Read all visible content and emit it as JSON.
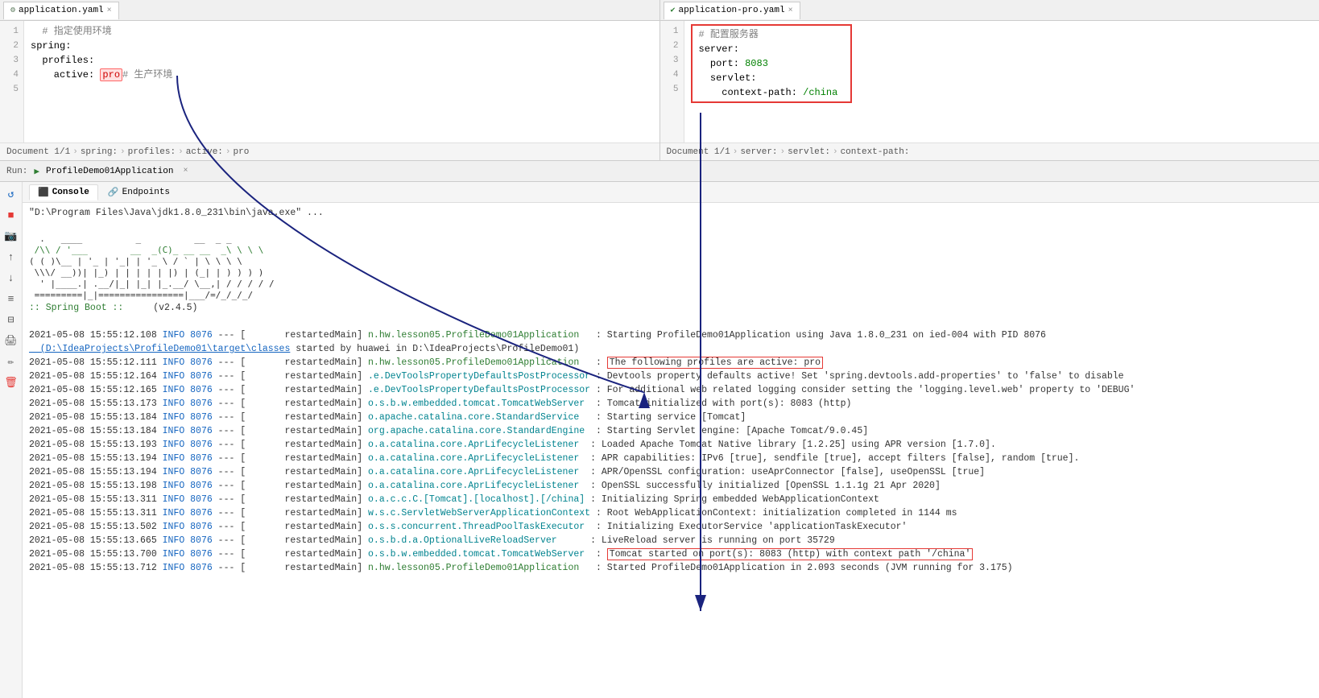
{
  "editors": {
    "left": {
      "tab_label": "application.yaml",
      "tab_icon": "⚙",
      "lines": [
        {
          "num": 1,
          "content": "  # 指定使用环境"
        },
        {
          "num": 2,
          "content": "spring:"
        },
        {
          "num": 3,
          "content": "  profiles:"
        },
        {
          "num": 4,
          "content": "    active: pro# 生产环境"
        },
        {
          "num": 5,
          "content": ""
        }
      ],
      "breadcrumb": [
        "Document 1/1",
        "spring:",
        "profiles:",
        "active:",
        "pro"
      ]
    },
    "right": {
      "tab_label": "application-pro.yaml",
      "tab_icon": "⚙",
      "lines": [
        {
          "num": 1,
          "content": "# 配置服务器"
        },
        {
          "num": 2,
          "content": "server:"
        },
        {
          "num": 3,
          "content": "  port: 8083"
        },
        {
          "num": 4,
          "content": "  servlet:"
        },
        {
          "num": 5,
          "content": "    context-path: /china"
        }
      ],
      "breadcrumb": [
        "Document 1/1",
        "server:",
        "servlet:",
        "context-path:"
      ]
    }
  },
  "run": {
    "label": "Run:",
    "app_name": "ProfileDemo01Application",
    "console_tab": "Console",
    "endpoints_tab": "Endpoints"
  },
  "console": {
    "java_cmd": "\"D:\\Program Files\\Java\\jdk1.8.0_231\\bin\\java.exe\" ...",
    "spring_boot_version": "(v2.4.5)",
    "spring_boot_label": ":: Spring Boot ::",
    "log_lines": [
      {
        "timestamp": "2021-05-08 15:55:12.108",
        "level": "INFO",
        "pid": "8076",
        "thread": "restartedMain",
        "class": "n.hw.lesson05.ProfileDemo01Application",
        "message": ": Starting ProfileDemo01Application using Java 1.8.0_231 on ied-004 with PID 8076"
      },
      {
        "indent": true,
        "message": "(D:\\IdeaProjects\\ProfileDemo01\\target\\classes started by huawei in D:\\IdeaProjects\\ProfileDemo01)"
      },
      {
        "timestamp": "2021-05-08 15:55:12.111",
        "level": "INFO",
        "pid": "8076",
        "thread": "restartedMain",
        "class": "n.hw.lesson05.ProfileDemo01Application",
        "message": ": The following profiles are active: pro",
        "highlight_msg": true
      },
      {
        "timestamp": "2021-05-08 15:55:12.164",
        "level": "INFO",
        "pid": "8076",
        "thread": "restartedMain",
        "class": ".e.DevToolsPropertyDefaultsPostProcessor",
        "message": ": Devtools property defaults active! Set 'spring.devtools.add-properties' to 'false' to disable"
      },
      {
        "timestamp": "2021-05-08 15:55:12.165",
        "level": "INFO",
        "pid": "8076",
        "thread": "restartedMain",
        "class": ".e.DevToolsPropertyDefaultsPostProcessor",
        "message": ": For additional web related logging consider setting the 'logging.level.web' property to 'DEBUG'"
      },
      {
        "timestamp": "2021-05-08 15:55:13.173",
        "level": "INFO",
        "pid": "8076",
        "thread": "restartedMain",
        "class": "o.s.b.w.embedded.tomcat.TomcatWebServer",
        "message": ": Tomcat initialized with port(s): 8083 (http)"
      },
      {
        "timestamp": "2021-05-08 15:55:13.184",
        "level": "INFO",
        "pid": "8076",
        "thread": "restartedMain",
        "class": "o.apache.catalina.core.StandardService",
        "message": ": Starting service [Tomcat]"
      },
      {
        "timestamp": "2021-05-08 15:55:13.184",
        "level": "INFO",
        "pid": "8076",
        "thread": "restartedMain",
        "class": "org.apache.catalina.core.StandardEngine",
        "message": ": Starting Servlet engine: [Apache Tomcat/9.0.45]"
      },
      {
        "timestamp": "2021-05-08 15:55:13.193",
        "level": "INFO",
        "pid": "8076",
        "thread": "restartedMain",
        "class": "o.a.catalina.core.AprLifecycleListener",
        "message": ": Loaded Apache Tomcat Native library [1.2.25] using APR version [1.7.0]."
      },
      {
        "timestamp": "2021-05-08 15:55:13.194",
        "level": "INFO",
        "pid": "8076",
        "thread": "restartedMain",
        "class": "o.a.catalina.core.AprLifecycleListener",
        "message": ": APR capabilities: IPv6 [true], sendfile [true], accept filters [false], random [true]."
      },
      {
        "timestamp": "2021-05-08 15:55:13.194",
        "level": "INFO",
        "pid": "8076",
        "thread": "restartedMain",
        "class": "o.a.catalina.core.AprLifecycleListener",
        "message": ": APR/OpenSSL configuration: useAprConnector [false], useOpenSSL [true]"
      },
      {
        "timestamp": "2021-05-08 15:55:13.198",
        "level": "INFO",
        "pid": "8076",
        "thread": "restartedMain",
        "class": "o.a.catalina.core.AprLifecycleListener",
        "message": ": OpenSSL successfully initialized [OpenSSL 1.1.1g  21 Apr 2020]"
      },
      {
        "timestamp": "2021-05-08 15:55:13.311",
        "level": "INFO",
        "pid": "8076",
        "thread": "restartedMain",
        "class": "o.a.c.c.C.[Tomcat].[localhost].[/china]",
        "message": ": Initializing Spring embedded WebApplicationContext"
      },
      {
        "timestamp": "2021-05-08 15:55:13.311",
        "level": "INFO",
        "pid": "8076",
        "thread": "restartedMain",
        "class": "w.s.c.ServletWebServerApplicationContext",
        "message": ": Root WebApplicationContext: initialization completed in 1144 ms"
      },
      {
        "timestamp": "2021-05-08 15:55:13.502",
        "level": "INFO",
        "pid": "8076",
        "thread": "restartedMain",
        "class": "o.s.s.concurrent.ThreadPoolTaskExecutor",
        "message": ": Initializing ExecutorService 'applicationTaskExecutor'"
      },
      {
        "timestamp": "2021-05-08 15:55:13.665",
        "level": "INFO",
        "pid": "8076",
        "thread": "restartedMain",
        "class": "o.s.b.d.a.OptionalLiveReloadServer",
        "message": ": LiveReload server is running on port 35729"
      },
      {
        "timestamp": "2021-05-08 15:55:13.700",
        "level": "INFO",
        "pid": "8076",
        "thread": "restartedMain",
        "class": "o.s.b.w.embedded.tomcat.TomcatWebServer",
        "message": ": Tomcat started on port(s): 8083 (http) with context path '/china'",
        "highlight_msg": true
      },
      {
        "timestamp": "2021-05-08 15:55:13.712",
        "level": "INFO",
        "pid": "8076",
        "thread": "restartedMain",
        "class": "n.hw.lesson05.ProfileDemo01Application",
        "message": ": Started ProfileDemo01Application in 2.093 seconds (JVM running for 3.175)"
      }
    ]
  }
}
